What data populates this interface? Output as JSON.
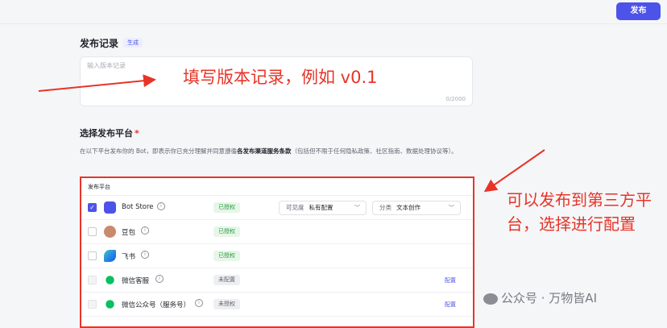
{
  "header": {
    "publish_label": "发布"
  },
  "record": {
    "title": "发布记录",
    "generate_tag": "生成",
    "placeholder": "输入版本记录",
    "counter": "0/2000",
    "annotation": "填写版本记录，例如 v0.1"
  },
  "platform": {
    "title": "选择发布平台",
    "required_mark": "*",
    "desc_before": "在以下平台发布你的 Bot，即表示你已充分理解并同意遵循",
    "desc_link": "各发布渠道服务条款",
    "desc_after": "（包括但不限于任何隐私政策、社区指南、数据处理协议等）。",
    "table_header": "发布平台",
    "annotation": "可以发布到第三方平台，选择进行配置",
    "rows": [
      {
        "name": "Bot Store",
        "status": "已授权",
        "checked": true,
        "visibility_label": "可见度",
        "visibility_value": "私有配置",
        "category_label": "分类",
        "category_value": "文本创作"
      },
      {
        "name": "豆包",
        "status": "已授权",
        "checked": false
      },
      {
        "name": "飞书",
        "status": "已授权",
        "checked": false
      },
      {
        "name": "微信客服",
        "status": "未配置",
        "checked": false,
        "action": "配置"
      },
      {
        "name": "微信公众号（服务号）",
        "status": "未授权",
        "checked": false,
        "action": "配置"
      }
    ]
  },
  "watermark": "公众号 · 万物皆AI",
  "colors": {
    "accent": "#4d53e8",
    "annotation": "#e83428",
    "ok": "#2a9d3a"
  },
  "icons": {
    "check": "✓",
    "info": "i",
    "chevron": "﹀"
  }
}
